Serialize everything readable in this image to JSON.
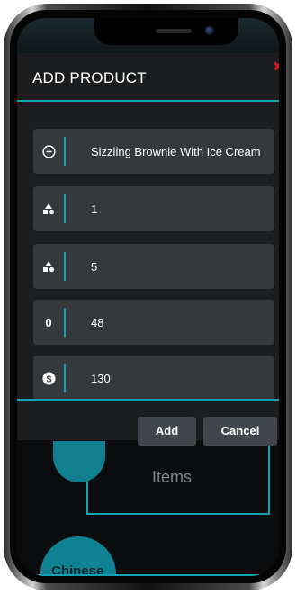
{
  "dialog": {
    "title": "ADD PRODUCT",
    "close_icon": "close-icon"
  },
  "fields": [
    {
      "icon": "plus-circle-icon",
      "value": "Sizzling Brownie With Ice Cream"
    },
    {
      "icon": "shapes-icon",
      "value": "1"
    },
    {
      "icon": "shapes-icon",
      "value": "5"
    },
    {
      "icon_text": "0",
      "value": "48"
    },
    {
      "icon": "dollar-icon",
      "value": "130"
    }
  ],
  "buttons": {
    "add_label": "Add",
    "cancel_label": "Cancel"
  },
  "background": {
    "card_label": "Items",
    "category_label": "Chinese"
  },
  "colors": {
    "accent": "#13a3b5",
    "dialog_bg": "#1b1d1f",
    "field_bg": "#36393c",
    "button_bg": "#40464b",
    "close": "#e0161b"
  }
}
